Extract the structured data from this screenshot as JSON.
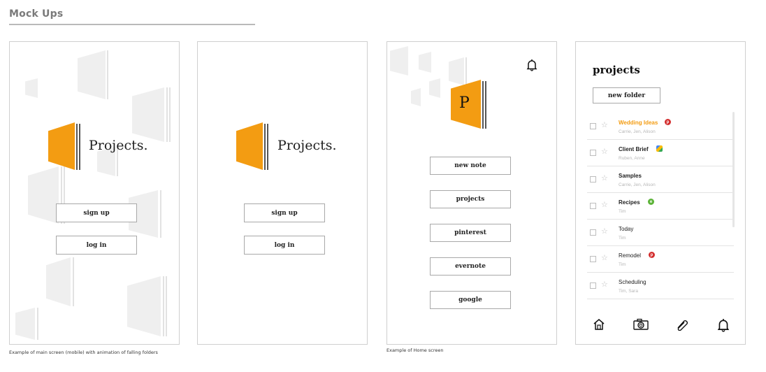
{
  "page": {
    "title": "Mock Ups"
  },
  "screen1": {
    "logo_text": "Projects.",
    "signup_label": "sign up",
    "login_label": "log in",
    "caption": "Example of main screen (mobile) with animation of falling folders"
  },
  "screen2": {
    "logo_text": "Projects.",
    "signup_label": "sign up",
    "login_label": "log in"
  },
  "screen3": {
    "logo_letter": "P",
    "menu": [
      "new note",
      "projects",
      "pinterest",
      "evernote",
      "google"
    ],
    "caption": "Example of Home screen"
  },
  "screen4": {
    "title": "projects",
    "new_folder_label": "new folder",
    "items": [
      {
        "name": "Wedding Ideas",
        "members": "Carrie, Jen, Alison",
        "app": "pinterest-icon"
      },
      {
        "name": "Client Brief",
        "members": "Ruben, Anne",
        "app": "google-drive-icon"
      },
      {
        "name": "Samples",
        "members": "Carrie, Jen, Alison",
        "app": ""
      },
      {
        "name": "Recipes",
        "members": "Tim",
        "app": "evernote-icon"
      },
      {
        "name": "Today",
        "members": "Tim",
        "app": ""
      },
      {
        "name": "Remodel",
        "members": "Tim",
        "app": "pinterest-icon"
      },
      {
        "name": "Scheduling",
        "members": "Tim, Sara",
        "app": ""
      }
    ],
    "nav_icons": [
      "home-icon",
      "camera-icon",
      "paperclip-icon",
      "bell-icon"
    ]
  },
  "colors": {
    "accent": "#f39c12",
    "pinterest": "#d32f2f",
    "evernote": "#5cb338"
  }
}
